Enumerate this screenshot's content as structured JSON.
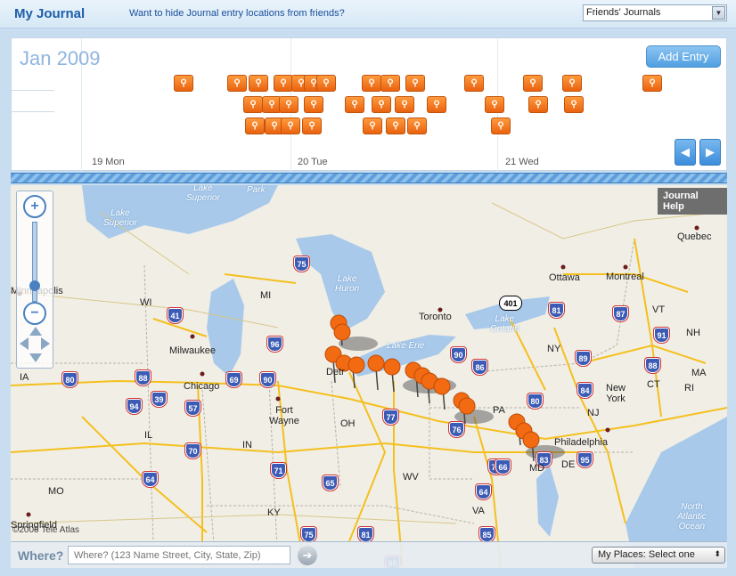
{
  "header": {
    "title": "My Journal",
    "hide_link": "Want to hide Journal entry locations from friends?",
    "journal_filter": "Friends' Journals"
  },
  "timeline": {
    "month": "Jan 2009",
    "add_entry_label": "Add Entry",
    "days": [
      "19 Mon",
      "20 Tue",
      "21 Wed"
    ],
    "pin_glyph": "⚲",
    "prev_label": "◀",
    "next_label": "▶"
  },
  "map": {
    "help_label": "Journal Help",
    "copyright": "©2008 Tele Atlas",
    "labels": {
      "minneapolis": "Minneapolis",
      "wi": "WI",
      "mi": "MI",
      "milwaukee": "Milwaukee",
      "chicago": "Chicago",
      "ia": "IA",
      "il": "IL",
      "in": "IN",
      "oh": "OH",
      "fort_wayne": "Fort\nWayne",
      "toronto": "Toronto",
      "ottawa": "Ottawa",
      "montreal": "Montreal",
      "quebec": "Quebec",
      "vt": "VT",
      "nh": "NH",
      "ny": "NY",
      "ma": "MA",
      "ct": "CT",
      "ri": "RI",
      "new_york": "New\nYork",
      "nj": "NJ",
      "pa": "PA",
      "philadelphia": "Philadelphia",
      "md": "MD",
      "de": "DE",
      "wv": "WV",
      "va": "VA",
      "ky": "KY",
      "mo": "MO",
      "springfield": "Springfield",
      "detroit": "Detr",
      "lake_superior": "Lake\nSuperior",
      "lake_huron": "Lake\nHuron",
      "lake_erie": "Lake Erie",
      "lake_ontario": "Lake\nOntario",
      "atlantic": "North\nAtlantic\nOcean",
      "park": "Park",
      "lake_superior_top": "Lake\nSuperior"
    },
    "shields": [
      "75",
      "41",
      "96",
      "80",
      "88",
      "90",
      "94",
      "39",
      "57",
      "69",
      "70",
      "71",
      "64",
      "65",
      "75",
      "77",
      "76",
      "90",
      "86",
      "81",
      "87",
      "89",
      "91",
      "88",
      "84",
      "95",
      "78",
      "80",
      "83",
      "66",
      "64",
      "81",
      "85",
      "95",
      "401"
    ]
  },
  "zoom": {
    "in_label": "+",
    "out_label": "−"
  },
  "search": {
    "where_label": "Where?",
    "placeholder": "Where? (123 Name Street, City, State, Zip)",
    "go_label": "➔",
    "places_label": "My Places: Select one",
    "places_arrow": "⬍"
  },
  "colors": {
    "water": "#a9c9ea",
    "land": "#f1eee6",
    "interstate": "#f4c01e",
    "pin": "#f26a12",
    "accent": "#1d5ea8"
  }
}
